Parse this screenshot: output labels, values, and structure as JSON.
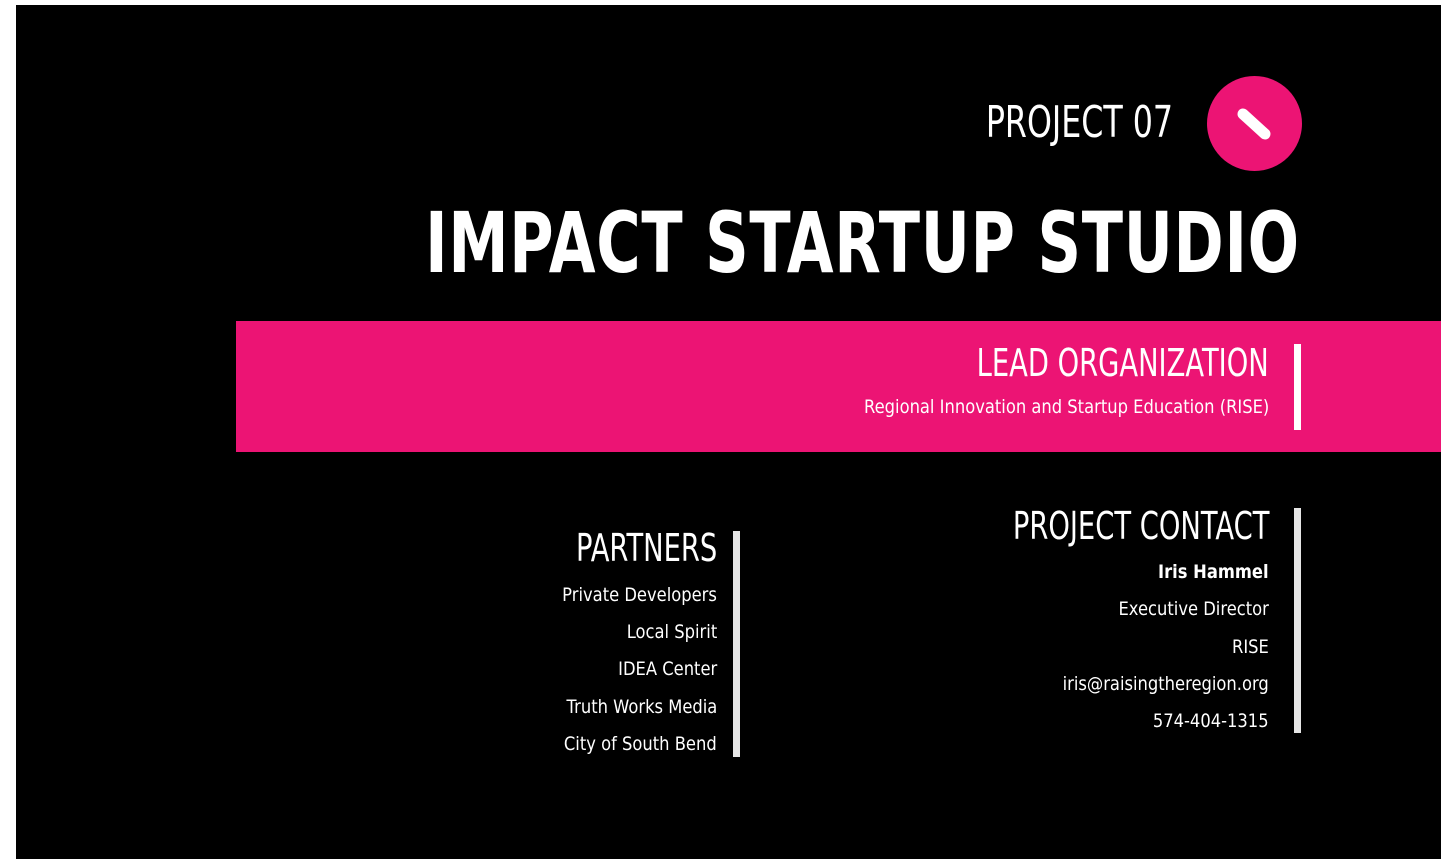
{
  "slide": {
    "project_number": "PROJECT 07",
    "badge_icon": "slash-icon",
    "title": "IMPACT STARTUP STUDIO"
  },
  "lead": {
    "heading": "LEAD ORGANIZATION",
    "organization": "Regional Innovation and Startup Education (RISE)"
  },
  "partners": {
    "heading": "PARTNERS",
    "items": [
      "Private Developers",
      "Local Spirit",
      "IDEA Center",
      "Truth Works Media",
      "City of South Bend"
    ]
  },
  "contact": {
    "heading": "PROJECT CONTACT",
    "name": "Iris Hammel",
    "role": "Executive Director",
    "organization": "RISE",
    "email": "iris@raisingtheregion.org",
    "phone": "574-404-1315"
  },
  "colors": {
    "background": "#000000",
    "accent": "#ec1474",
    "text": "#ffffff"
  }
}
